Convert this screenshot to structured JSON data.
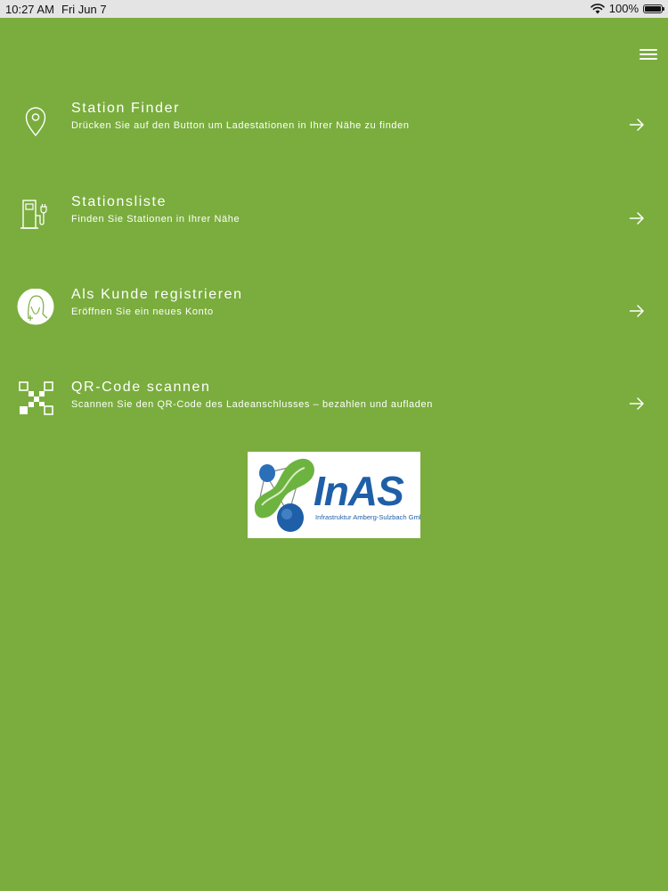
{
  "status_bar": {
    "time": "10:27 AM",
    "date": "Fri Jun 7",
    "battery": "100%",
    "icons": [
      "wifi-icon",
      "battery-icon"
    ]
  },
  "header": {
    "menu_icon": "hamburger-menu-icon"
  },
  "menu": {
    "items": [
      {
        "icon": "location-pin-icon",
        "title": "Station Finder",
        "subtitle": "Drücken Sie auf den Button um Ladestationen in Ihrer Nähe zu finden"
      },
      {
        "icon": "charging-station-icon",
        "title": "Stationsliste",
        "subtitle": "Finden Sie Stationen in Ihrer Nähe"
      },
      {
        "icon": "user-add-icon",
        "title": "Als Kunde registrieren",
        "subtitle": "Eröffnen Sie ein neues Konto"
      },
      {
        "icon": "qr-code-icon",
        "title": "QR-Code scannen",
        "subtitle": "Scannen Sie den QR-Code des Ladeanschlusses – bezahlen und aufladen"
      }
    ]
  },
  "logo": {
    "name": "InAS",
    "tagline": "Infrastruktur Amberg-Sulzbach GmbH",
    "colors": {
      "blue": "#1f5fa8",
      "green": "#6cb33f"
    }
  },
  "colors": {
    "background": "#7aad3d",
    "status_bar": "#e4e4e4"
  }
}
